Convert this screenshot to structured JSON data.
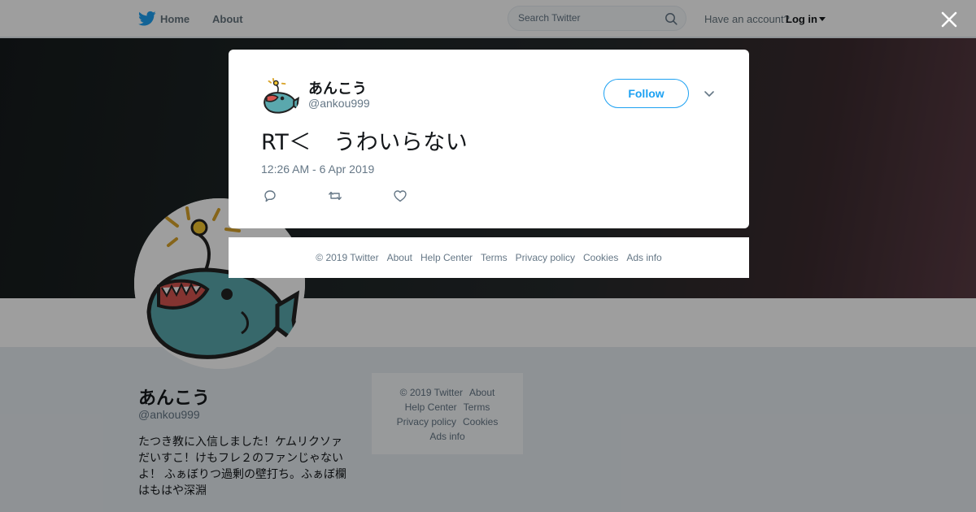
{
  "nav": {
    "home_label": "Home",
    "about_label": "About",
    "search_placeholder": "Search Twitter",
    "have_account": "Have an account?",
    "login_label": "Log in"
  },
  "profile": {
    "name": "あんこう",
    "handle": "@ankou999",
    "bio": "たつき教に入信しました！ケムリクソァだいすこ！けもフレ２のファンじゃないよ！ ふぁぼりつ過剰の壁打ち。ふぁぼ欄はもはや深淵"
  },
  "profile_footer": {
    "items": [
      "© 2019 Twitter",
      "About",
      "Help Center",
      "Terms",
      "Privacy policy",
      "Cookies",
      "Ads info"
    ]
  },
  "tweet": {
    "name": "あんこう",
    "handle": "@ankou999",
    "follow_label": "Follow",
    "text": "RT＜　うわいらない",
    "timestamp": "12:26 AM - 6 Apr 2019"
  },
  "modal_footer": {
    "items": [
      "© 2019 Twitter",
      "About",
      "Help Center",
      "Terms",
      "Privacy policy",
      "Cookies",
      "Ads info"
    ]
  },
  "icons": {
    "logo": "twitter-bird-icon",
    "search": "search-icon",
    "close": "close-icon",
    "reply": "reply-icon",
    "retweet": "retweet-icon",
    "like": "heart-icon",
    "more": "chevron-down-icon"
  },
  "colors": {
    "brand": "#1da1f2",
    "text": "#14171a",
    "secondary": "#657786",
    "avatar_fish": "#5aa8ad"
  }
}
